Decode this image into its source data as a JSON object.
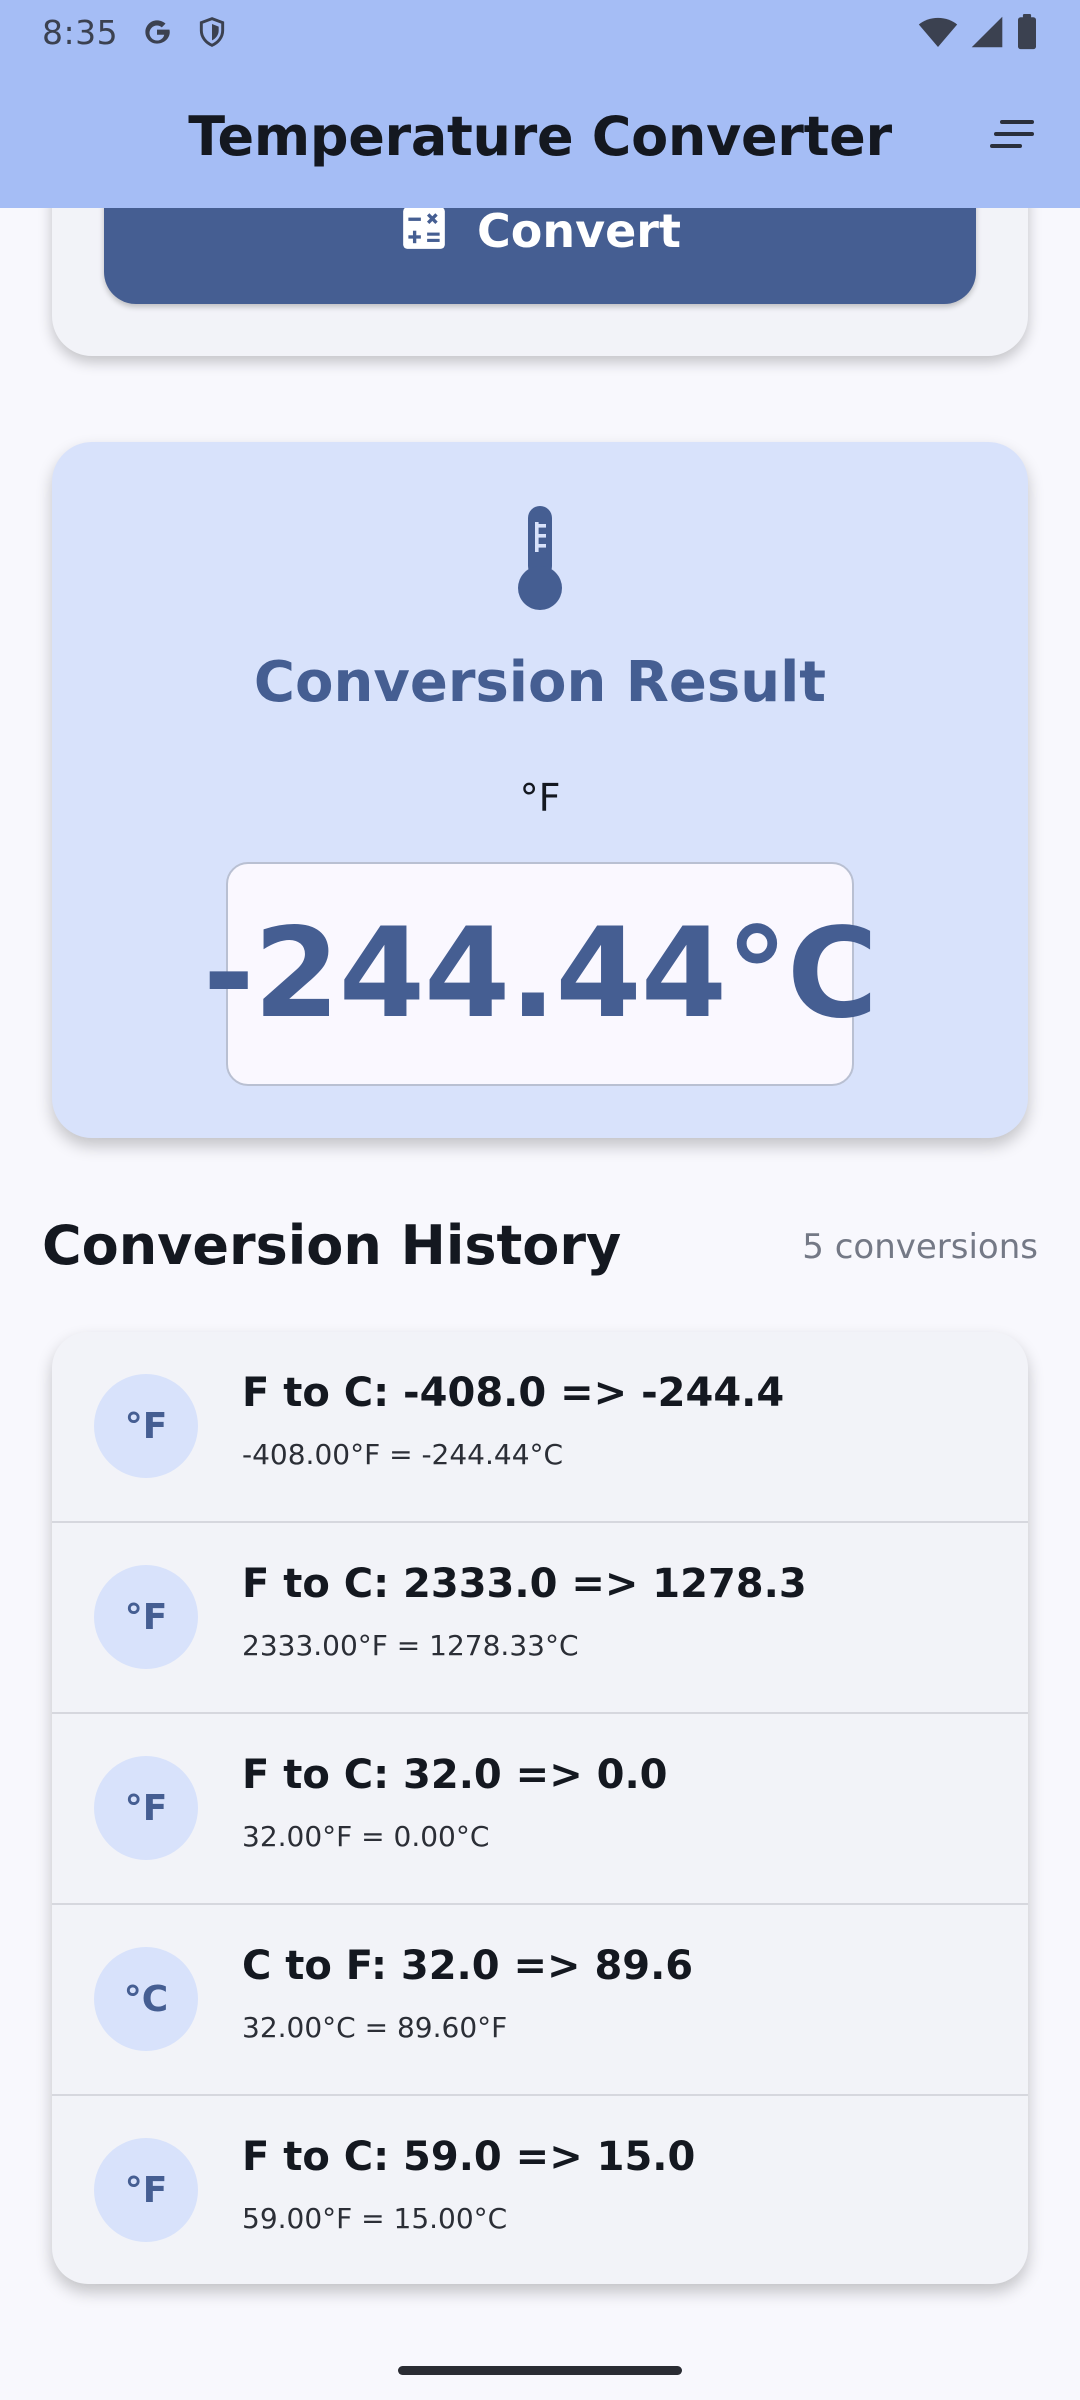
{
  "status_bar": {
    "time": "8:35",
    "left_icons": [
      "google-icon",
      "shield-icon"
    ],
    "right_icons": [
      "wifi-icon",
      "signal-icon",
      "battery-icon"
    ]
  },
  "app_bar": {
    "title": "Temperature Converter",
    "menu_icon": "sort-menu-icon"
  },
  "convert": {
    "label": "Convert",
    "icon": "calculator-icon"
  },
  "result": {
    "icon": "thermometer-icon",
    "title": "Conversion Result",
    "unit": "°F",
    "value": "-244.44°C"
  },
  "history": {
    "title": "Conversion History",
    "count": "5 conversions",
    "items": [
      {
        "badge": "°F",
        "title": "F to C: -408.0 => -244.4",
        "detail": "-408.00°F = -244.44°C"
      },
      {
        "badge": "°F",
        "title": "F to C: 2333.0 => 1278.3",
        "detail": "2333.00°F = 1278.33°C"
      },
      {
        "badge": "°F",
        "title": "F to C: 32.0 => 0.0",
        "detail": "32.00°F = 0.00°C"
      },
      {
        "badge": "°C",
        "title": "C to F: 32.0 => 89.6",
        "detail": "32.00°C = 89.60°F"
      },
      {
        "badge": "°F",
        "title": "F to C: 59.0 => 15.0",
        "detail": "59.00°F = 15.00°C"
      }
    ]
  },
  "colors": {
    "app_bar": "#a5bdf5",
    "primary": "#455e92",
    "result_card": "#d8e2fb",
    "surface": "#f2f3f8",
    "background": "#f8f8fd"
  }
}
